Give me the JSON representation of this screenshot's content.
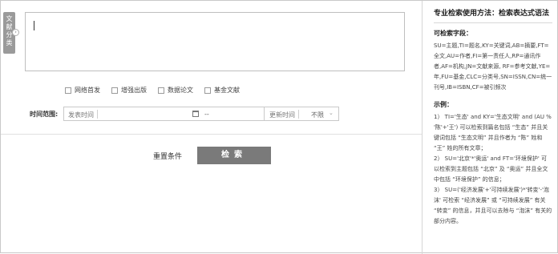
{
  "side_tab": {
    "label_chars": [
      "文",
      "献",
      "分",
      "类"
    ],
    "toggle": "›"
  },
  "expression_box": {
    "value": ""
  },
  "filters": [
    {
      "label": "网络首发"
    },
    {
      "label": "增强出版"
    },
    {
      "label": "数据论文"
    },
    {
      "label": "基金文献"
    }
  ],
  "time": {
    "label": "时间范围:",
    "publish_caption": "发表时间",
    "range_separator": "--",
    "update_caption": "更新时间",
    "update_value": "不限",
    "chevron": "⌄"
  },
  "actions": {
    "reset": "重置条件",
    "search": "检索"
  },
  "help": {
    "title": "专业检索使用方法：检索表达式语法",
    "fields_heading": "可检索字段：",
    "fields_text": "SU=主题,TI=题名,KY=关键词,AB=摘要,FT=全文,AU=作者,FI=第一责任人,RP=通讯作者,AF=机构,JN=文献来源, RF=参考文献,YE=年,FU=基金,CLC=分类号,SN=ISSN,CN=统一刊号,IB=ISBN,CF=被引频次",
    "examples_heading": "示例：",
    "examples": [
      "1） TI='生态' and KY='生态文明' and (AU % '陈'+'王') 可以检索到篇名包括 “生态” 并且关键词包括 “生态文明” 并且作者为 “陈” 姓和 “王” 姓的所有文章；",
      "2） SU='北京'*'奥运' and FT='环境保护' 可以检索到主题包括 “北京” 及 “奥运” 并且全文中包括 “环境保护” 的信息；",
      "3） SU=('经济发展'+'可持续发展')*'转变'-'泡沫' 可检索 “经济发展” 或 “可持续发展” 有关 “转变” 的信息，并且可以去除与 “泡沫” 有关的部分内容。"
    ]
  }
}
